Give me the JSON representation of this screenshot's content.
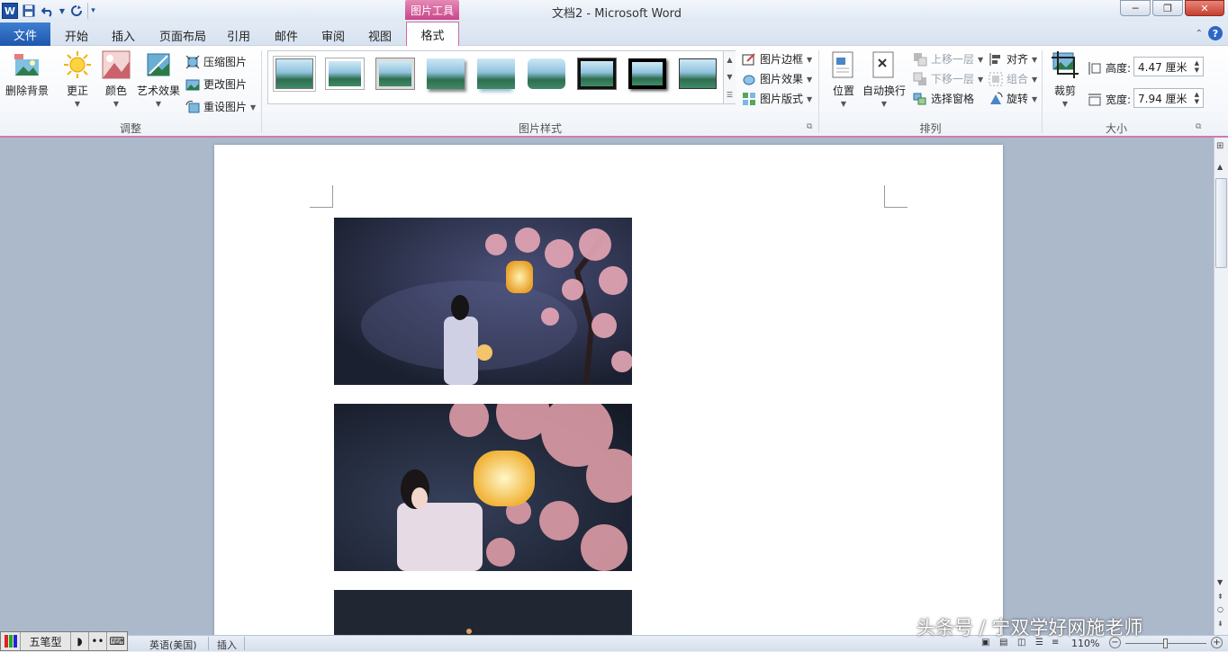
{
  "window": {
    "title": "文档2 - Microsoft Word",
    "context_header": "图片工具",
    "minimize": "─",
    "restore": "❐",
    "close": "✕"
  },
  "qat": {
    "app_icon": "W",
    "save_icon": "floppy-icon",
    "undo_icon": "undo-icon",
    "redo_icon": "redo-icon",
    "customize_icon": "dropdown-icon"
  },
  "tabs": {
    "file": "文件",
    "home": "开始",
    "insert": "插入",
    "layout": "页面布局",
    "references": "引用",
    "mailings": "邮件",
    "review": "审阅",
    "view": "视图",
    "format": "格式"
  },
  "ribbon": {
    "adjust": {
      "label": "调整",
      "remove_bg": "删除背景",
      "corrections": "更正",
      "color": "颜色",
      "artistic": "艺术效果",
      "compress": "压缩图片",
      "change": "更改图片",
      "reset": "重设图片"
    },
    "styles": {
      "label": "图片样式",
      "border": "图片边框",
      "effects": "图片效果",
      "layout": "图片版式"
    },
    "arrange": {
      "label": "排列",
      "position": "位置",
      "wrap": "自动换行",
      "bring_forward": "上移一层",
      "send_backward": "下移一层",
      "selection_pane": "选择窗格",
      "align": "对齐",
      "group": "组合",
      "rotate": "旋转"
    },
    "size": {
      "label": "大小",
      "crop": "裁剪",
      "height_label": "高度:",
      "height_value": "4.47 厘米",
      "width_label": "宽度:",
      "width_value": "7.94 厘米"
    }
  },
  "status": {
    "ime_name": "五笔型",
    "language": "英语(美国)",
    "mode": "插入",
    "zoom": "110%"
  },
  "watermark": "头条号 / 宁双学好网施老师",
  "colors": {
    "accent": "#1d57ad",
    "context": "#c9468a",
    "page": "#ffffff",
    "doc_bg": "#abb9cb"
  }
}
